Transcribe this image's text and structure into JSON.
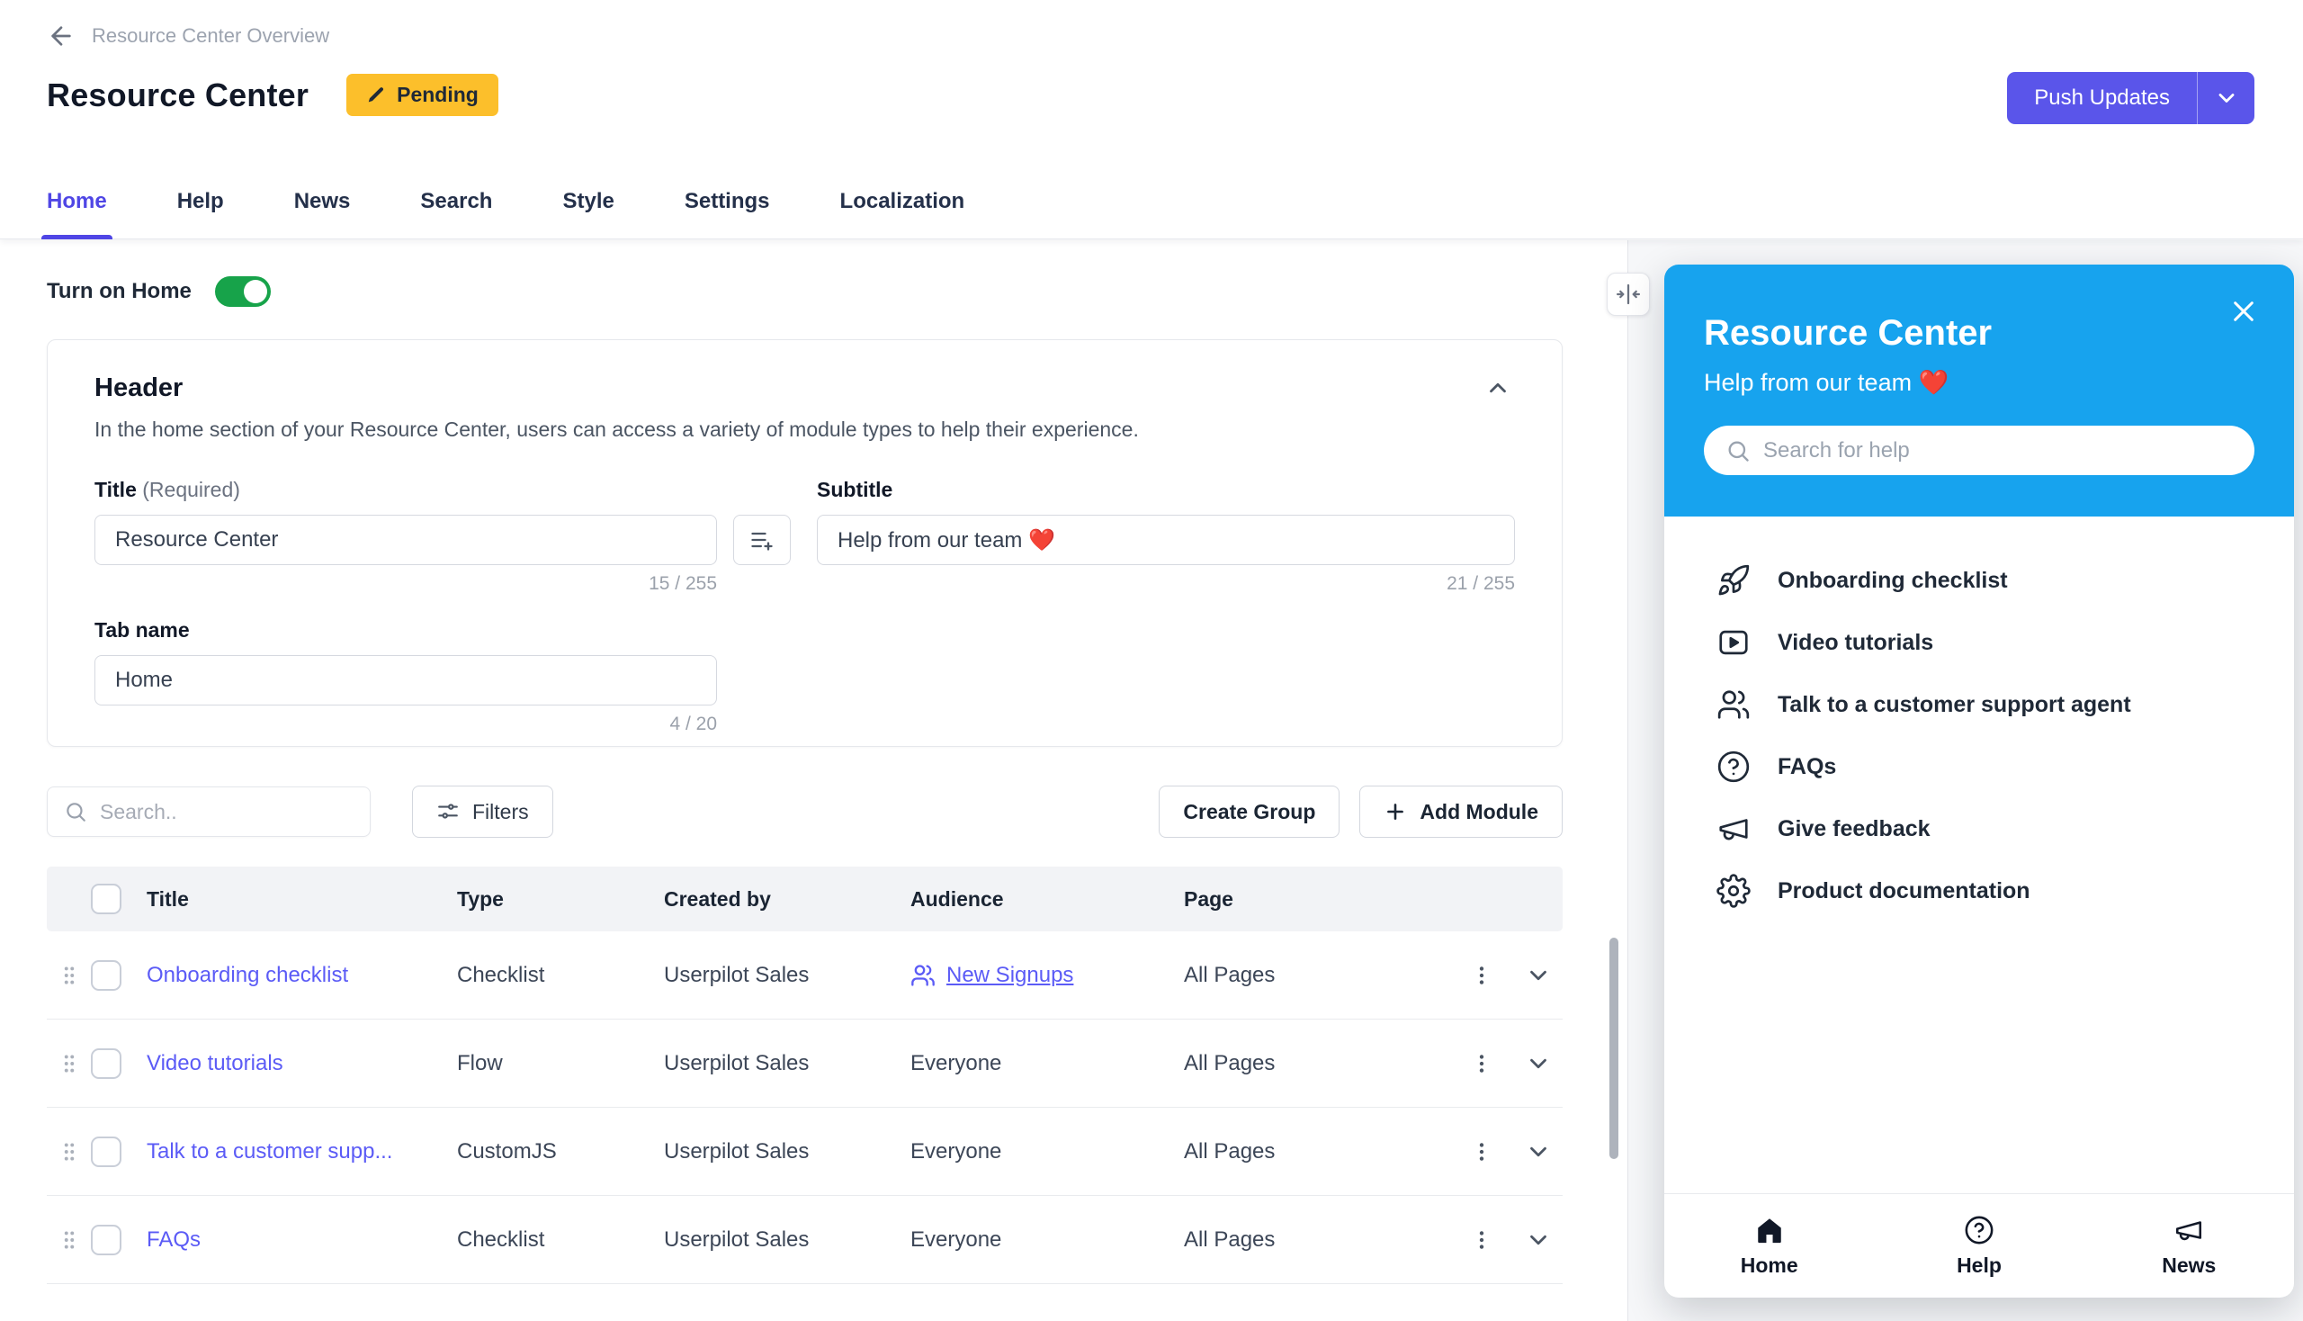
{
  "breadcrumb": {
    "label": "Resource Center Overview"
  },
  "page": {
    "title": "Resource Center",
    "status_badge": "Pending",
    "push_updates_label": "Push Updates"
  },
  "tabs": {
    "items": [
      "Home",
      "Help",
      "News",
      "Search",
      "Style",
      "Settings",
      "Localization"
    ],
    "active": "Home"
  },
  "home_section": {
    "toggle_label": "Turn on Home",
    "toggle_on": true,
    "card": {
      "title": "Header",
      "description": "In the home section of your Resource Center, users can access a variety of module types to help their experience.",
      "fields": {
        "title": {
          "label": "Title",
          "required": "(Required)",
          "value": "Resource Center",
          "counter": "15 / 255"
        },
        "subtitle": {
          "label": "Subtitle",
          "value": "Help from our team ❤️",
          "counter": "21 / 255"
        },
        "tab_name": {
          "label": "Tab name",
          "value": "Home",
          "counter": "4 / 20"
        }
      }
    },
    "toolbar": {
      "search_placeholder": "Search..",
      "filters_label": "Filters",
      "create_group_label": "Create Group",
      "add_module_label": "Add Module"
    },
    "table": {
      "headers": {
        "title": "Title",
        "type": "Type",
        "created_by": "Created by",
        "audience": "Audience",
        "page": "Page"
      },
      "rows": [
        {
          "title": "Onboarding checklist",
          "type": "Checklist",
          "created_by": "Userpilot Sales",
          "audience": "New Signups",
          "audience_is_link": true,
          "page": "All Pages"
        },
        {
          "title": "Video tutorials",
          "type": "Flow",
          "created_by": "Userpilot Sales",
          "audience": "Everyone",
          "audience_is_link": false,
          "page": "All Pages"
        },
        {
          "title": "Talk to a customer supp...",
          "type": "CustomJS",
          "created_by": "Userpilot Sales",
          "audience": "Everyone",
          "audience_is_link": false,
          "page": "All Pages"
        },
        {
          "title": "FAQs",
          "type": "Checklist",
          "created_by": "Userpilot Sales",
          "audience": "Everyone",
          "audience_is_link": false,
          "page": "All Pages"
        }
      ]
    }
  },
  "preview": {
    "title": "Resource Center",
    "subtitle": "Help from our team ❤️",
    "search_placeholder": "Search for help",
    "items": [
      {
        "label": "Onboarding checklist",
        "icon": "rocket-icon"
      },
      {
        "label": "Video tutorials",
        "icon": "video-icon"
      },
      {
        "label": "Talk to a customer support agent",
        "icon": "users-icon"
      },
      {
        "label": "FAQs",
        "icon": "question-icon"
      },
      {
        "label": "Give feedback",
        "icon": "megaphone-icon"
      },
      {
        "label": "Product documentation",
        "icon": "gear-icon"
      }
    ],
    "nav": [
      {
        "label": "Home",
        "icon": "home-icon",
        "active": true
      },
      {
        "label": "Help",
        "icon": "question-icon",
        "active": false
      },
      {
        "label": "News",
        "icon": "megaphone-icon",
        "active": false
      }
    ]
  },
  "colors": {
    "accent_link": "#5b5bf6",
    "primary_button": "#5a55ea",
    "active_tab": "#4f46e5",
    "badge_bg": "#fcbf2b",
    "toggle_on": "#17a34a",
    "preview_header": "#17a3ee"
  }
}
